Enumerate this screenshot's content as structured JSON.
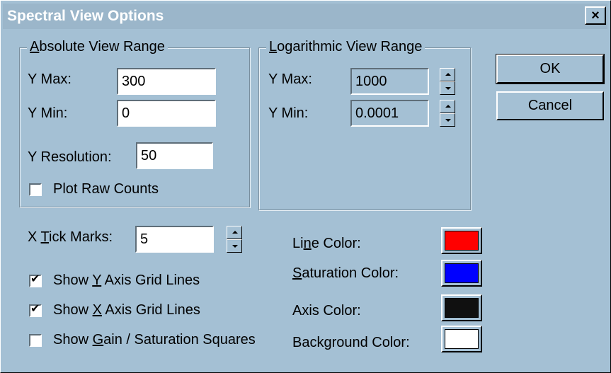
{
  "window": {
    "title": "Spectral View Options",
    "close_glyph": "×"
  },
  "absolute_group": {
    "legend_mnemonic": "A",
    "legend_rest": "bsolute View Range",
    "ymax_label": "Y Max:",
    "ymax_value": "300",
    "ymin_label": "Y Min:",
    "ymin_value": "0",
    "yres_label": "Y Resolution:",
    "yres_value": "50",
    "plot_raw_label": "Plot Raw Counts",
    "plot_raw_checked": false
  },
  "log_group": {
    "legend_mnemonic": "L",
    "legend_rest": "ogarithmic View Range",
    "ymax_label": "Y Max:",
    "ymax_value": "1000",
    "ymin_label": "Y Min:",
    "ymin_value": "0.0001"
  },
  "buttons": {
    "ok": "OK",
    "cancel": "Cancel"
  },
  "tick": {
    "label_pre": "X ",
    "label_mnemonic": "T",
    "label_post": "ick Marks:",
    "value": "5"
  },
  "checkboxes": {
    "show_y_pre": "Show ",
    "show_y_mn": "Y",
    "show_y_post": " Axis Grid Lines",
    "show_y_checked": true,
    "show_x_pre": "Show ",
    "show_x_mn": "X",
    "show_x_post": " Axis Grid Lines",
    "show_x_checked": true,
    "show_gain_pre": "Show ",
    "show_gain_mn": "G",
    "show_gain_post": "ain / Saturation Squares",
    "show_gain_checked": false,
    "check_glyph": "✔"
  },
  "colors": {
    "line_pre": "Li",
    "line_mn": "n",
    "line_post": "e Color:",
    "line_value": "#ff0000",
    "sat_mn": "S",
    "sat_post": "aturation Color:",
    "sat_value": "#0000ff",
    "axis_label": "Axis Color:",
    "axis_value": "#101010",
    "bg_label": "Background Color:",
    "bg_value": "#ffffff"
  }
}
